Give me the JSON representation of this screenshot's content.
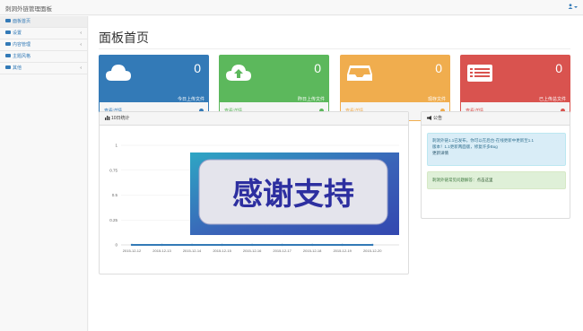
{
  "app": {
    "title": "刺洞外链管理面板"
  },
  "sidebar": {
    "items": [
      {
        "label": "面板首页",
        "icon": "dashboard-icon",
        "active": true
      },
      {
        "label": "设置",
        "icon": "wrench-icon"
      },
      {
        "label": "内容管理",
        "icon": "list-icon"
      },
      {
        "label": "主题风格",
        "icon": "palette-icon"
      },
      {
        "label": "其他",
        "icon": "caret-icon"
      }
    ]
  },
  "page": {
    "title": "面板首页"
  },
  "stats": [
    {
      "value": "0",
      "caption": "今日上传文件",
      "link": "查看详情",
      "icon": "cloud-icon",
      "color": "#337ab7"
    },
    {
      "value": "0",
      "caption": "昨日上传文件",
      "link": "查看详情",
      "icon": "cloud-upload-icon",
      "color": "#5cb85c"
    },
    {
      "value": "0",
      "caption": "现存文件",
      "link": "查看详情",
      "icon": "inbox-icon",
      "color": "#f0ad4e"
    },
    {
      "value": "0",
      "caption": "已上传总文件",
      "link": "查看详情",
      "icon": "list-alt-icon",
      "color": "#d9534f"
    }
  ],
  "chart_panel": {
    "title": "10日统计"
  },
  "chart_data": {
    "type": "line",
    "x": [
      "2015-12-12",
      "2015-12-13",
      "2015-12-14",
      "2015-12-15",
      "2015-12-16",
      "2015-12-17",
      "2015-12-18",
      "2015-12-19",
      "2015-12-20"
    ],
    "series": [
      {
        "values": [
          0,
          0,
          0,
          0,
          0,
          0,
          0,
          0,
          0
        ],
        "color": "#337ab7"
      }
    ],
    "yticks": [
      "1",
      "0.75",
      "0.5",
      "0.25",
      "0"
    ],
    "ylim": [
      0,
      1
    ]
  },
  "promo": {
    "text": "感谢支持"
  },
  "notice_panel": {
    "title": "公告",
    "info_lines": [
      "刺洞外链1.1已发布，你可以在后台-在线更新中更新至1.1",
      "版本！1.1更新两面版，修复许多Bug"
    ],
    "info_link": "更新详情",
    "success_text": "刺洞外链常见问题解答：",
    "success_link": "点击这里"
  }
}
